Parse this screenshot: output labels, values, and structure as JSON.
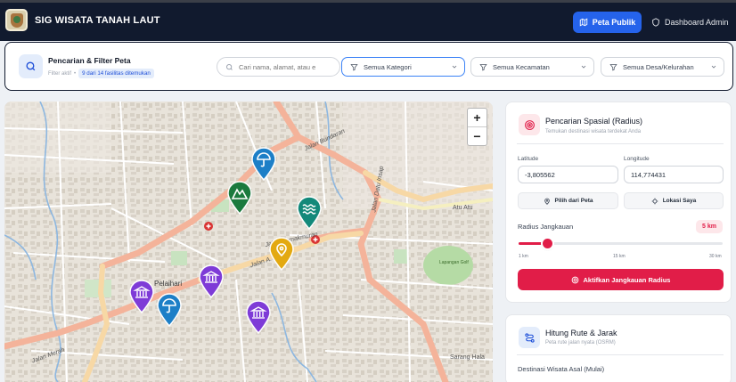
{
  "navbar": {
    "title": "SIG WISATA TANAH LAUT",
    "public_map_label": "Peta Publik",
    "admin_label": "Dashboard Admin"
  },
  "filter": {
    "title": "Pencarian & Filter Peta",
    "active_prefix": "Filter aktif",
    "count_text": "9 dari 14 fasilitas ditemukan",
    "search_placeholder": "Cari nama, alamat, atau e",
    "category_select": "Semua Kategori",
    "district_select": "Semua Kecamatan",
    "village_select": "Semua Desa/Kelurahan"
  },
  "map": {
    "zoom_in": "+",
    "zoom_out": "−",
    "labels": {
      "pelaihari": "Pelaihari",
      "atu_atu": "Atu Atu",
      "lapangan_golf": "Lapangan Golf",
      "sarang_halang": "Sarang Hala",
      "jalan_bundaran": "Jalan Bundaran",
      "jalan_a_yani": "Jalan A. Yani",
      "jalan_datu_insap": "Jalan Datu Insap",
      "jalan_kemakmuran": "Jalan Kemakmuran",
      "jalan_merah": "Jalan Merah"
    },
    "pins": [
      {
        "name": "pin-beach",
        "icon": "umbrella-icon",
        "color": "#1d7fc7"
      },
      {
        "name": "pin-mountain",
        "icon": "mountain-icon",
        "color": "#1b7a3e"
      },
      {
        "name": "pin-water",
        "icon": "waves-icon",
        "color": "#13897a"
      },
      {
        "name": "pin-location",
        "icon": "map-pin-icon",
        "color": "#e3a911"
      },
      {
        "name": "pin-museum-1",
        "icon": "museum-icon",
        "color": "#7e3bd7"
      },
      {
        "name": "pin-museum-2",
        "icon": "museum-icon",
        "color": "#7e3bd7"
      },
      {
        "name": "pin-beach-2",
        "icon": "umbrella-icon",
        "color": "#1d7fc7"
      },
      {
        "name": "pin-museum-3",
        "icon": "museum-icon",
        "color": "#7e3bd7"
      }
    ]
  },
  "spatial": {
    "title": "Pencarian Spasial (Radius)",
    "subtitle": "Temukan destinasi wisata terdekat Anda",
    "latitude_label": "Latitude",
    "latitude_value": "-3,805562",
    "longitude_label": "Longitude",
    "longitude_value": "114,774431",
    "pick_map_label": "Pilih dari Peta",
    "my_location_label": "Lokasi Saya",
    "radius_label": "Radius Jangkauan",
    "radius_value": "5 km",
    "radius_fraction": 0.14,
    "tick_min": "1 km",
    "tick_mid": "15 km",
    "tick_max": "30 km",
    "activate_label": "Aktifkan Jangkauan Radius"
  },
  "route": {
    "title": "Hitung Rute & Jarak",
    "subtitle": "Peta rute jalan nyata (OSRM)",
    "origin_label": "Destinasi Wisata Asal (Mulai)"
  },
  "colors": {
    "navbar": "#111a2e",
    "primary": "#2563eb",
    "accent": "#e11d48"
  }
}
